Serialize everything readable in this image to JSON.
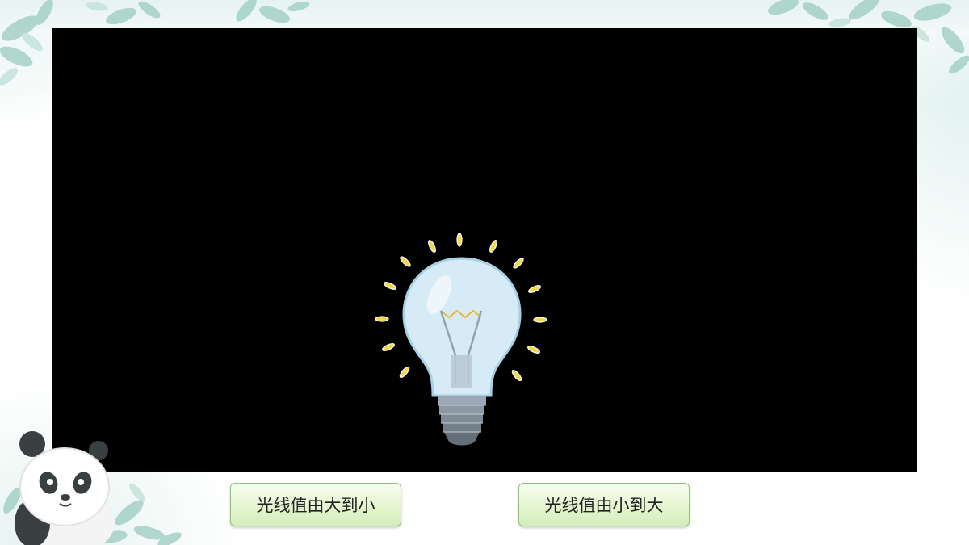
{
  "slide": {
    "background_color": "#ffffff",
    "accent_color": "#dff0ec"
  },
  "video": {
    "background_color": "#000000",
    "subject_icon": "light-bulb-icon"
  },
  "choices": [
    {
      "label": "光线值由大到小"
    },
    {
      "label": "光线值由小到大"
    }
  ],
  "decorations": {
    "mascot_icon": "panda-icon",
    "foliage_icon": "leaf-icon"
  }
}
